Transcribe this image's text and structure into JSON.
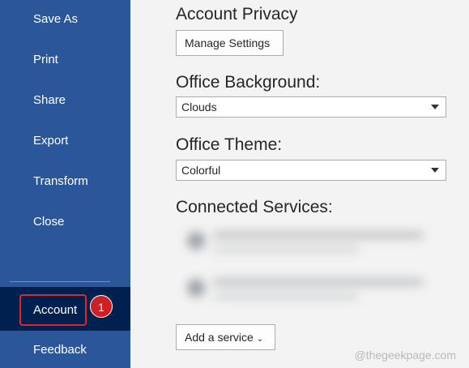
{
  "sidebar": {
    "items": [
      {
        "label": "Save As"
      },
      {
        "label": "Print"
      },
      {
        "label": "Share"
      },
      {
        "label": "Export"
      },
      {
        "label": "Transform"
      },
      {
        "label": "Close"
      }
    ],
    "account_label": "Account",
    "feedback_label": "Feedback",
    "step_badge": "1",
    "colors": {
      "sidebar_bg": "#2b579a",
      "selected_bg": "#002050",
      "highlight_border": "#e3242b"
    }
  },
  "main": {
    "privacy": {
      "heading": "Account Privacy",
      "button_label": "Manage Settings"
    },
    "background": {
      "heading": "Office Background:",
      "selected": "Clouds"
    },
    "theme": {
      "heading": "Office Theme:",
      "selected": "Colorful"
    },
    "services": {
      "heading": "Connected Services:",
      "add_button_label": "Add a service"
    }
  },
  "watermark": "@thegeekpage.com"
}
